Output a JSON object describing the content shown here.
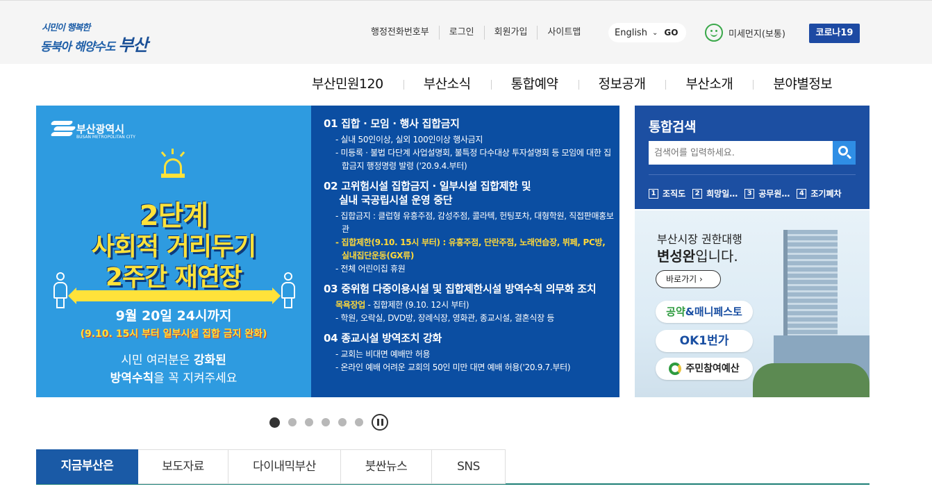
{
  "header": {
    "logo": {
      "line1": "시민이 행복한",
      "line2_prefix": "동북아 해양수도",
      "line2_city": "부산"
    },
    "utility_links": [
      "행정전화번호부",
      "로그인",
      "회원가입",
      "사이트맵"
    ],
    "language": {
      "selected": "English",
      "go_label": "GO"
    },
    "dust_status": "미세먼지(보통)",
    "covid_button": "코로나19"
  },
  "gnb": [
    "부산민원120",
    "부산소식",
    "통합예약",
    "정보공개",
    "부산소개",
    "분야별정보"
  ],
  "banner": {
    "org_name": "부산광역시",
    "org_name_en": "BUSAN METROPOLITAN CITY",
    "headline": [
      "2단계",
      "사회적 거리두기",
      "2주간 재연장"
    ],
    "deadline": "9월 20일 24시까지",
    "relaxation": "(9.10. 15시 부터 일부시설 집합 금지 완화)",
    "plea_line1_prefix": "시민 여러분은 ",
    "plea_line1_bold": "강화된",
    "plea_line2_bold": "방역수칙",
    "plea_line2_suffix": "을 꼭 지켜주세요",
    "rules": [
      {
        "title": "01 집합 · 모임 · 행사 집합금지",
        "items": [
          "- 실내 50인이상, 실외 100인이상 행사금지",
          "- 미등록 · 불법 다단계 사업설명회, 불특정 다수대상 투자설명회 등 모임에 대한 집합금지 행정명령 발령 ('20.9.4.부터)"
        ]
      },
      {
        "title": "02 고위험시설 집합금지 · 일부시설 집합제한 및",
        "title_cont": "실내 국공립시설 운영 중단",
        "items": [
          "- 집합금지 : 클럽형 유흥주점, 감성주점, 콜라텍, 헌팅포차, 대형학원, 직접판매홍보관",
          "- 집합제한(9.10. 15시 부터) : 유흥주점, 단란주점, 노래연습장, 뷔페, PC방, 실내집단운동(GX류)",
          "- 전체 어린이집 휴원"
        ]
      },
      {
        "title": "03 중위험 다중이용시설 및 집합제한시설 방역수칙 의무화 조치",
        "items": [
          "- 집합제한 (9.10. 12시 부터)",
          "- 학원, 오락실, DVD방, 장례식장, 영화관, 종교시설, 결혼식장 등"
        ],
        "highlight_prefix": "목욕장업"
      },
      {
        "title": "04 종교시설 방역조치 강화",
        "items": [
          "- 교회는 비대면 예배만 허용",
          "- 온라인 예배 어려운 교회의 50인 미만 대면 예배 허용('20.9.7.부터)"
        ]
      }
    ],
    "slide_count": 6,
    "active_slide": 1
  },
  "search": {
    "title": "통합검색",
    "placeholder": "검색어를 입력하세요.",
    "keywords": [
      {
        "num": "1",
        "label": "조직도"
      },
      {
        "num": "2",
        "label": "희망일…"
      },
      {
        "num": "3",
        "label": "공무원…"
      },
      {
        "num": "4",
        "label": "조기폐차"
      }
    ]
  },
  "mayor_ad": {
    "line1": "부산시장 권한대행",
    "name": "변성완",
    "line2_suffix": "입니다.",
    "go_label": "바로가기",
    "pill1_a": "공약",
    "pill1_b": "&매니페스토",
    "pill2": "OK1번가",
    "pill3": "주민참여예산"
  },
  "tabs": [
    "지금부산은",
    "보도자료",
    "다이내믹부산",
    "붓싼뉴스",
    "SNS"
  ],
  "colors": {
    "primary_blue": "#1c4fa2",
    "banner_light_blue": "#2e9be0",
    "highlight_yellow": "#ffe23a",
    "tab_underline": "#1c7e75"
  }
}
